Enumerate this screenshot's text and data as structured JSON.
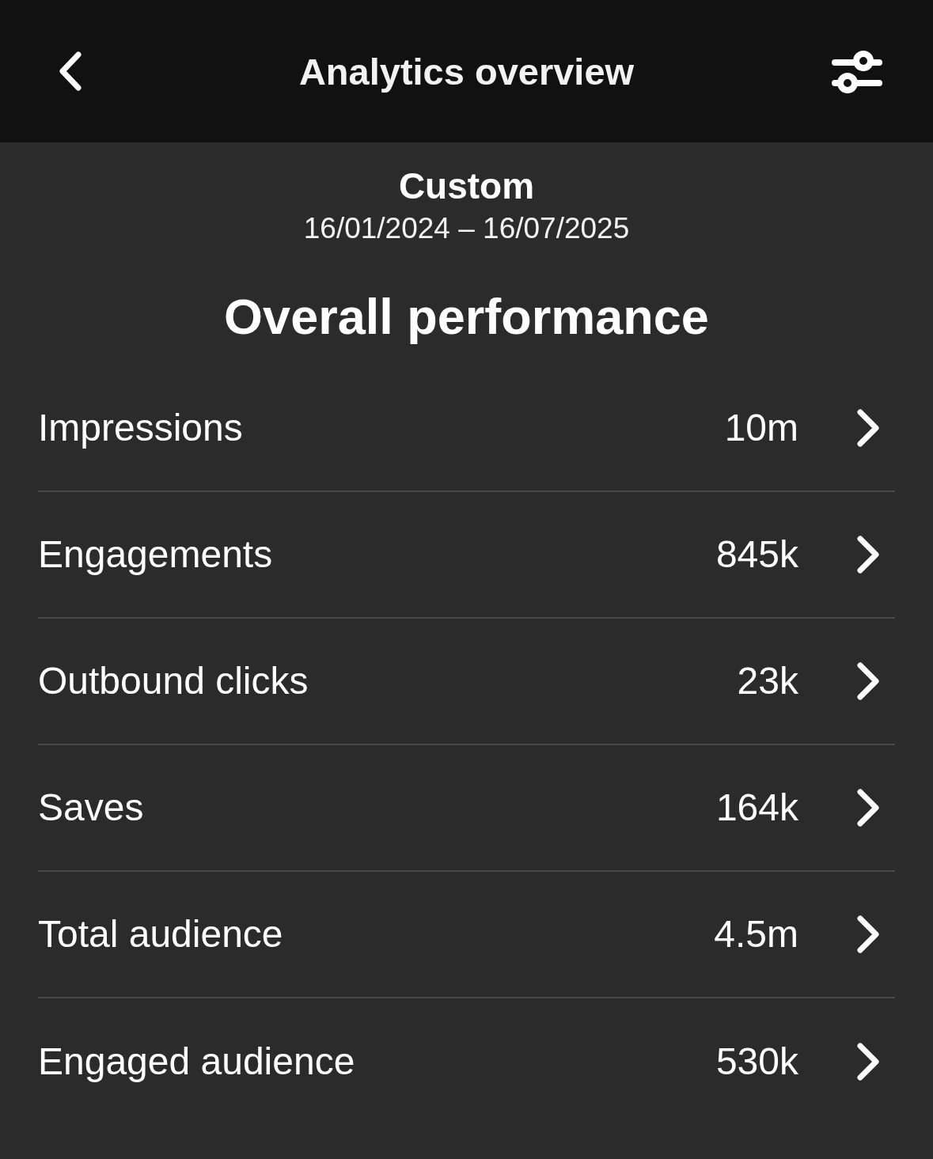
{
  "header": {
    "title": "Analytics overview"
  },
  "date_range": {
    "label": "Custom",
    "range": "16/01/2024 – 16/07/2025"
  },
  "section": {
    "title": "Overall performance"
  },
  "metrics": [
    {
      "label": "Impressions",
      "value": "10m"
    },
    {
      "label": "Engagements",
      "value": "845k"
    },
    {
      "label": "Outbound clicks",
      "value": "23k"
    },
    {
      "label": "Saves",
      "value": "164k"
    },
    {
      "label": "Total audience",
      "value": "4.5m"
    },
    {
      "label": "Engaged audience",
      "value": "530k"
    }
  ]
}
